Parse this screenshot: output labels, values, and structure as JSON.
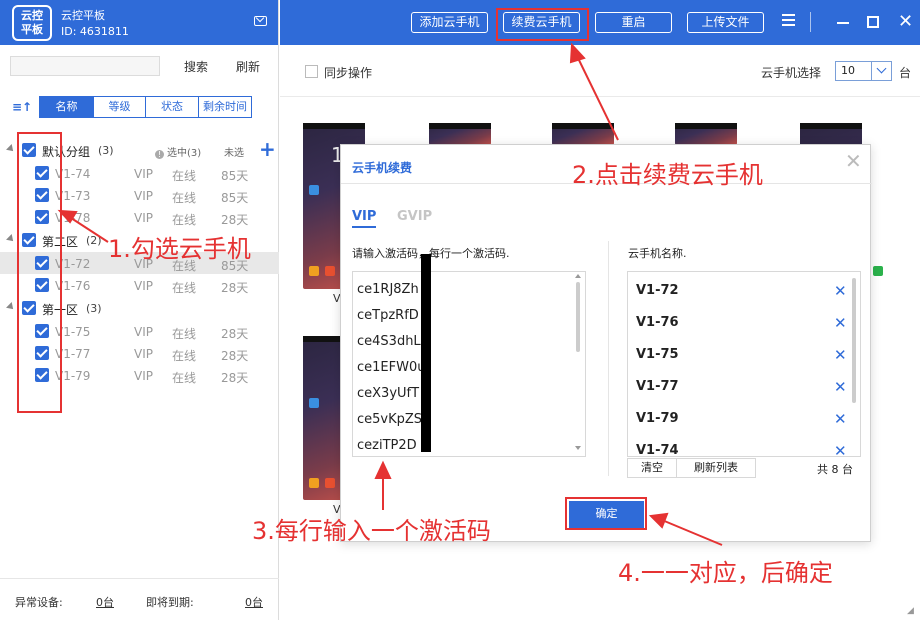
{
  "app": {
    "logo_text_line1": "云控",
    "logo_text_line2": "平板",
    "title": "云控平板",
    "id_text": "ID: 4631811"
  },
  "left": {
    "search_label": "搜索",
    "refresh_label": "刷新",
    "tabs": [
      "名称",
      "等级",
      "状态",
      "剩余时间"
    ],
    "groups": [
      {
        "name": "默认分组",
        "count": "(3)",
        "selected_info": "选中(3)",
        "unselected_info": "未选",
        "devices": [
          {
            "name": "V1-74",
            "level": "VIP",
            "status": "在线",
            "days": "85天"
          },
          {
            "name": "V1-73",
            "level": "VIP",
            "status": "在线",
            "days": "85天"
          },
          {
            "name": "V1-78",
            "level": "VIP",
            "status": "在线",
            "days": "28天"
          }
        ]
      },
      {
        "name": "第二区",
        "count": "(2)",
        "devices": [
          {
            "name": "V1-72",
            "level": "VIP",
            "status": "在线",
            "days": "85天"
          },
          {
            "name": "V1-76",
            "level": "VIP",
            "status": "在线",
            "days": "28天"
          }
        ]
      },
      {
        "name": "第一区",
        "count": "(3)",
        "devices": [
          {
            "name": "V1-75",
            "level": "VIP",
            "status": "在线",
            "days": "28天"
          },
          {
            "name": "V1-77",
            "level": "VIP",
            "status": "在线",
            "days": "28天"
          },
          {
            "name": "V1-79",
            "level": "VIP",
            "status": "在线",
            "days": "28天"
          }
        ]
      }
    ],
    "footer": {
      "abnormal_label": "异常设备:",
      "abnormal_value": "0台",
      "expiring_label": "即将到期:",
      "expiring_value": "0台"
    }
  },
  "topbar": {
    "add_phone": "添加云手机",
    "renew_phone": "续费云手机",
    "restart": "重启",
    "upload": "上传文件"
  },
  "toolbar": {
    "sync_label": "同步操作",
    "phone_select_label": "云手机选择",
    "phone_select_value": "10",
    "unit": "台"
  },
  "thumbs": {
    "clock_digit": "1",
    "label_a": "V",
    "label_b": "V"
  },
  "modal": {
    "title": "云手机续费",
    "tab_vip": "VIP",
    "tab_gvip": "GVIP",
    "code_label": "请输入激活码，每行一个激活码.",
    "names_label": "云手机名称.",
    "codes": [
      "ce1RJ8Zh",
      "ceTpzRfD",
      "ce4S3dhL",
      "ce1EFW0u",
      "ceX3yUfT",
      "ce5vKpZS",
      "ceziTP2D"
    ],
    "names": [
      "V1-72",
      "V1-76",
      "V1-75",
      "V1-77",
      "V1-79",
      "V1-74"
    ],
    "clear_label": "清空",
    "refresh_list_label": "刷新列表",
    "total": "共 8 台",
    "confirm": "确定"
  },
  "annotations": {
    "step1": "1.勾选云手机",
    "step2": "2.点击续费云手机",
    "step3": "3.每行输入一个激活码",
    "step4": "4.一一对应，后确定"
  },
  "colors": {
    "brand_blue": "#2f6bd8",
    "annotation_red": "#e53232"
  }
}
